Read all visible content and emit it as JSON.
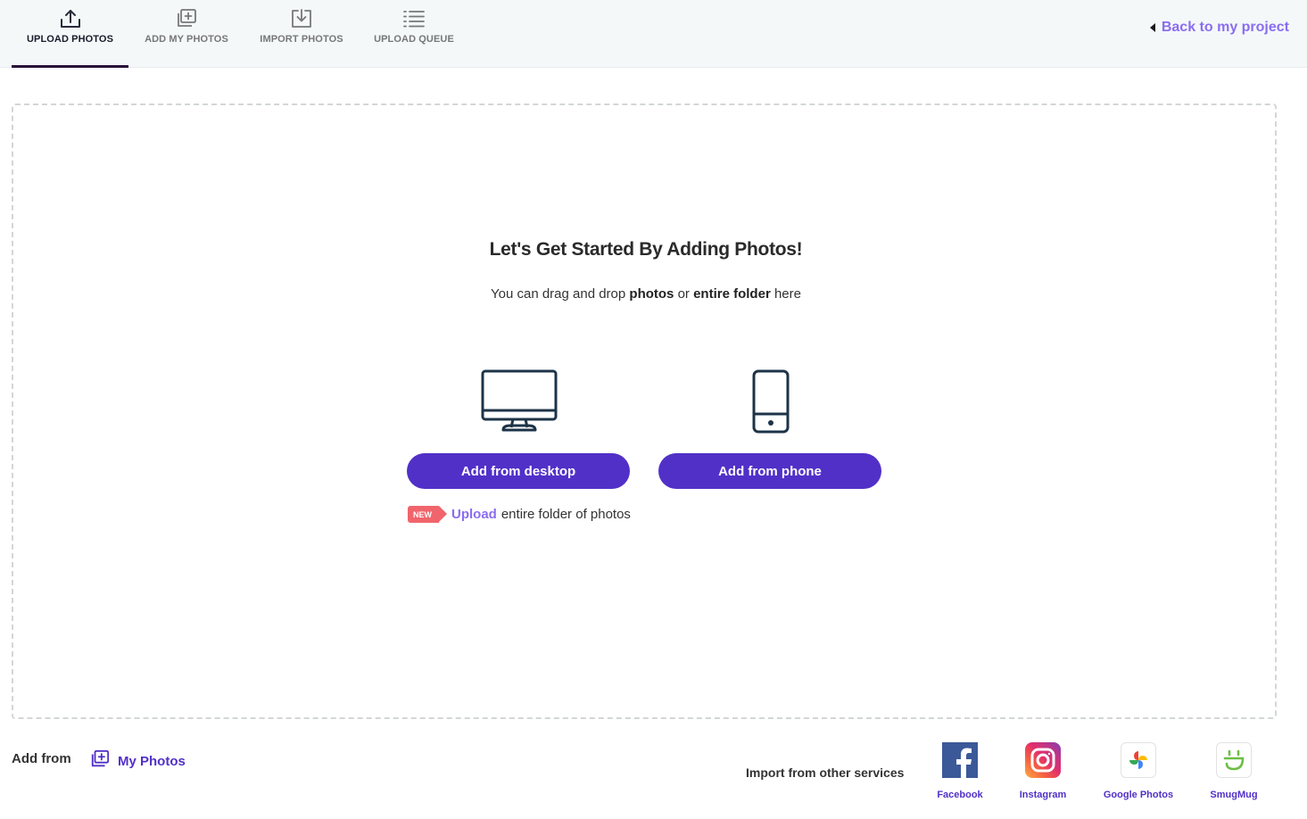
{
  "tabs": [
    {
      "label": "UPLOAD PHOTOS",
      "icon": "upload-icon",
      "active": true
    },
    {
      "label": "ADD MY PHOTOS",
      "icon": "add-photo-icon",
      "active": false
    },
    {
      "label": "IMPORT PHOTOS",
      "icon": "import-icon",
      "active": false
    },
    {
      "label": "UPLOAD QUEUE",
      "icon": "list-icon",
      "active": false
    }
  ],
  "back_link": {
    "label": "Back to my project",
    "icon": "caret-left-icon"
  },
  "dropzone": {
    "heading": "Let's Get Started By Adding Photos!",
    "sub_prefix": "You can drag and drop ",
    "sub_bold1": "photos",
    "sub_mid": " or ",
    "sub_bold2": "entire folder",
    "sub_suffix": " here",
    "desktop_icon": "desktop-monitor-icon",
    "phone_icon": "smartphone-icon",
    "desktop_button": "Add from desktop",
    "phone_button": "Add from phone",
    "new_badge": "NEW",
    "folder_link": "Upload",
    "folder_text": "entire folder of photos"
  },
  "bottom": {
    "add_from_label": "Add from",
    "my_photos_label": "My Photos",
    "my_photos_icon": "add-photo-icon",
    "import_label": "Import from other services",
    "services": [
      {
        "label": "Facebook",
        "icon": "facebook-icon"
      },
      {
        "label": "Instagram",
        "icon": "instagram-icon"
      },
      {
        "label": "Google Photos",
        "icon": "google-photos-icon"
      },
      {
        "label": "SmugMug",
        "icon": "smugmug-icon"
      }
    ]
  },
  "colors": {
    "accent": "#5130c8",
    "link": "#8a6df0",
    "new_badge": "#f0656b",
    "icon_dark": "#1d3448"
  }
}
